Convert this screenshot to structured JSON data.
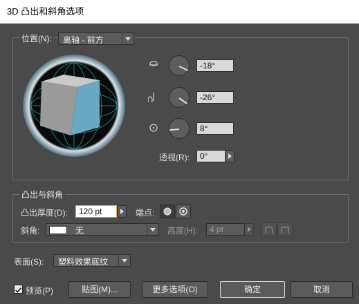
{
  "title": "3D 凸出和斜角选项",
  "position": {
    "label": "位置(N):",
    "preset": "离轴 - 前方",
    "rot_x": "-18°",
    "rot_y": "-26°",
    "rot_z": "8°",
    "perspective_label": "透视(R):",
    "perspective_value": "0°"
  },
  "extrude": {
    "group_label": "凸出与斜角",
    "depth_label": "凸出厚度(D):",
    "depth_value": "120 pt",
    "cap_label": "端点:",
    "bevel_label": "斜角:",
    "bevel_value": "无",
    "height_label": "高度(H):",
    "height_value": "4 pt"
  },
  "surface": {
    "label": "表面(S):",
    "value": "塑料效果底纹"
  },
  "footer": {
    "preview_label": "预览(P)",
    "preview_checked": true,
    "map_button": "贴图(M)...",
    "more_button": "更多选项(O)",
    "ok_button": "确定",
    "cancel_button": "取消"
  },
  "colors": {
    "panel": "#4a4a4a",
    "cube_front": "#6aa8c4",
    "cube_top": "#c9c9c9",
    "cube_side": "#9a9a9a",
    "grid": "#19c6c6"
  }
}
